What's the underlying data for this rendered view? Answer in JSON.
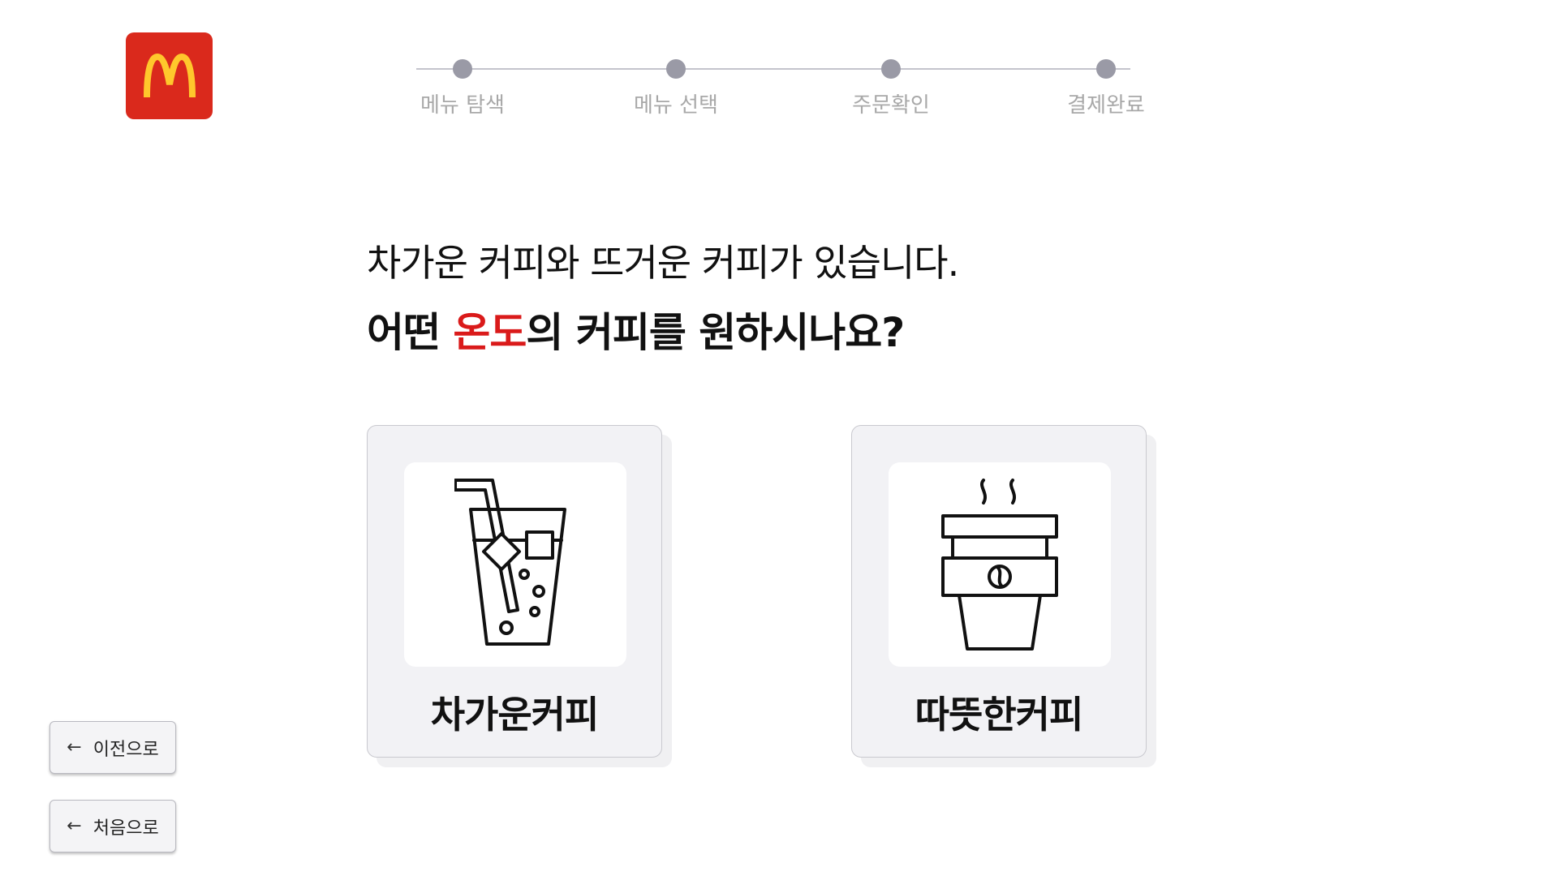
{
  "brand": {
    "logo_name": "mcdonalds-golden-arches-logo",
    "logo_bg": "#da291c",
    "logo_arch_color": "#ffc72c"
  },
  "stepper": {
    "steps": [
      {
        "label": "메뉴 탐색"
      },
      {
        "label": "메뉴 선택"
      },
      {
        "label": "주문확인"
      },
      {
        "label": "결제완료"
      }
    ],
    "dot_color": "#9a9aa6",
    "line_color": "#c4c4cc",
    "label_color": "#a8a8a8"
  },
  "question": {
    "line1": "차가운 커피와 뜨거운 커피가 있습니다.",
    "line2_prefix": "어떤 ",
    "line2_highlight": "온도",
    "line2_suffix": "의 커피를 원하시나요?",
    "highlight_color": "#da1a1a"
  },
  "options": [
    {
      "label": "차가운커피",
      "icon": "iced-coffee-icon"
    },
    {
      "label": "따뜻한커피",
      "icon": "hot-coffee-cup-icon"
    }
  ],
  "nav": {
    "prev_label": "이전으로",
    "home_label": "처음으로",
    "arrow_icon": "arrow-left-icon"
  }
}
